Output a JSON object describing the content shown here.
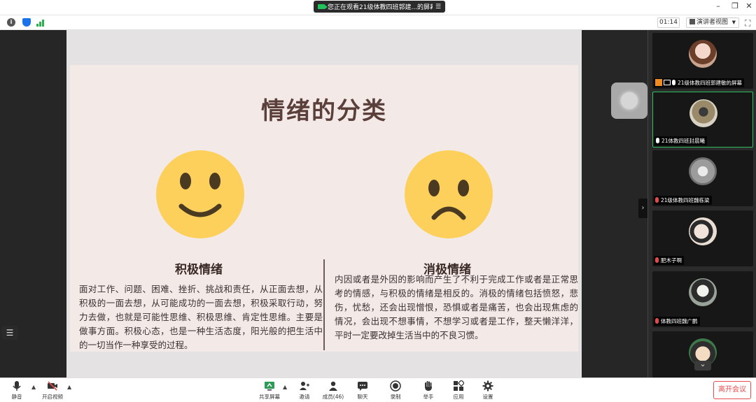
{
  "titlebar": {
    "share_text": "您正在观看21级体教四班郭建...的屏幕",
    "menu_glyph": "☰",
    "minimize": "–",
    "restore": "❐",
    "close": "✕"
  },
  "infobar": {
    "timer": "01:14",
    "view_label": "演讲者视图",
    "fullscreen_glyph": "⛶"
  },
  "slide": {
    "title": "情绪的分类",
    "positive": {
      "heading": "积极情绪",
      "body": "面对工作、问题、困难、挫折、挑战和责任，从正面去想，从积极的一面去想，从可能成功的一面去想，积极采取行动，努力去做，也就是可能性思维、积极思维、肯定性思维。主要是做事方面。积极心态，也是一种生活态度，阳光般的把生活中的一切当作一种享受的过程。"
    },
    "negative": {
      "heading": "消极情绪",
      "body": "内因或者是外因的影响而产生了不利于完成工作或者是正常思考的情感，与积极的情绪是相反的。消极的情绪包括愤怒，悲伤，忧愁，还会出现憎恨，恐惧或者是痛苦，也会出现焦虑的情况，会出现不想事情，不想学习或者是工作，整天懒洋洋，平时一定要改掉生活当中的不良习惯。"
    }
  },
  "panel": {
    "participants": [
      {
        "name": "21级体教四班郭建敏的屏幕",
        "mic": "on",
        "host": true
      },
      {
        "name": "21体教四班封晨曦",
        "mic": "on",
        "host": false
      },
      {
        "name": "21级体教四班魏栋梁",
        "mic": "off",
        "host": false
      },
      {
        "name": "肥木子啊",
        "mic": "off",
        "host": false
      },
      {
        "name": "体教四班魏广鹏",
        "mic": "off",
        "host": false
      }
    ],
    "scroll_down_glyph": "⌄"
  },
  "toolbar": {
    "mute": "静音",
    "video": "开启视频",
    "share": "共享屏幕",
    "invite": "邀请",
    "members": "成员(46)",
    "chat": "聊天",
    "record": "录制",
    "raise_hand": "举手",
    "apps": "应用",
    "settings": "设置",
    "leave": "离开会议"
  },
  "colors": {
    "accent_green": "#2fbf5d",
    "face_yellow": "#fcd05a",
    "leave_red": "#e84c4c",
    "slide_bg": "#f3e9e7"
  }
}
